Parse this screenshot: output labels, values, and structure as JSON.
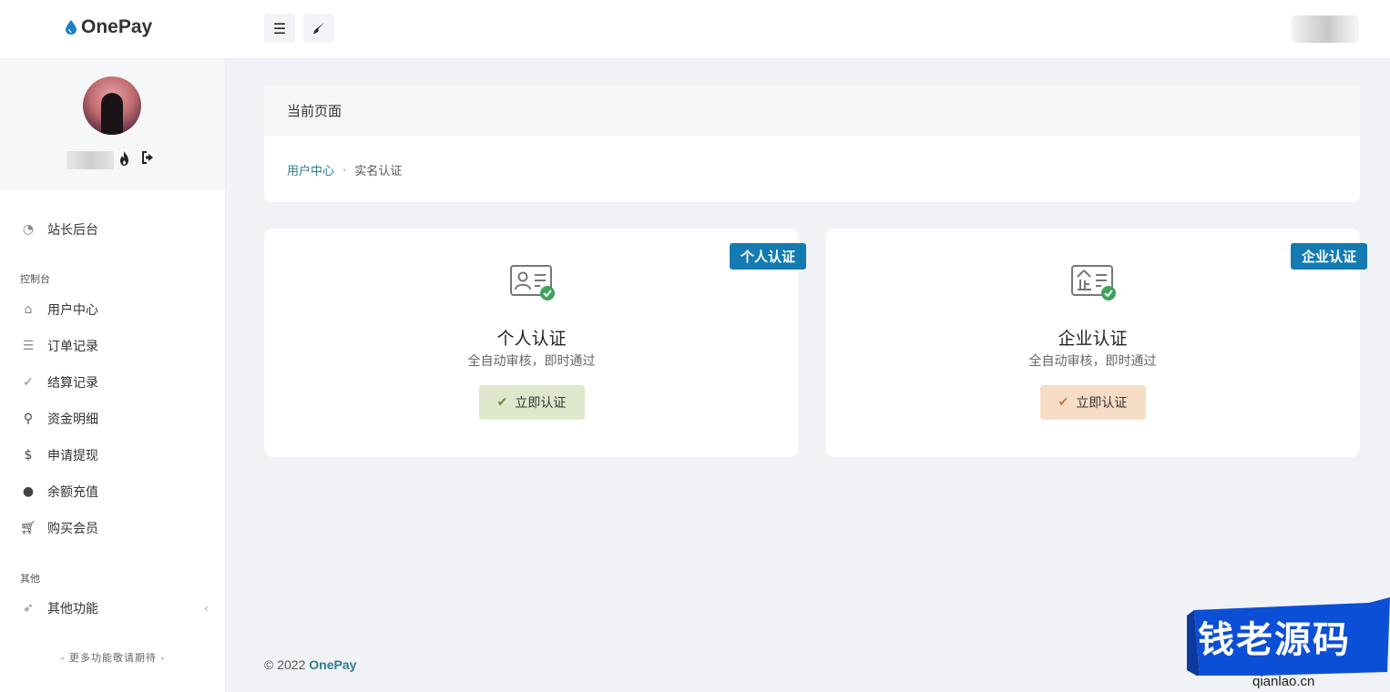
{
  "header": {
    "logo_text": "OnePay",
    "menu_icon": "hamburger-icon",
    "brush_icon": "brush-icon"
  },
  "sidebar": {
    "nav_items": [
      {
        "label": "站长后台",
        "icon": "dashboard-icon"
      },
      {
        "label": "用户中心",
        "icon": "home-icon"
      },
      {
        "label": "订单记录",
        "icon": "list-icon"
      },
      {
        "label": "结算记录",
        "icon": "check-circle-icon"
      },
      {
        "label": "资金明细",
        "icon": "search-money-icon"
      },
      {
        "label": "申请提现",
        "icon": "dollar-icon"
      },
      {
        "label": "余额充值",
        "icon": "coin-bag-icon"
      },
      {
        "label": "购买会员",
        "icon": "cart-icon"
      },
      {
        "label": "其他功能",
        "icon": "rocket-icon"
      }
    ],
    "section_console": "控制台",
    "section_other": "其他",
    "footer_text": "- 更多功能敬请期待 -"
  },
  "page": {
    "card_title": "当前页面",
    "breadcrumb_home": "用户中心",
    "breadcrumb_current": "实名认证"
  },
  "auth": {
    "personal": {
      "badge": "个人认证",
      "title": "个人认证",
      "desc": "全自动审核，即时通过",
      "button": "立即认证"
    },
    "business": {
      "badge": "企业认证",
      "title": "企业认证",
      "desc": "全自动审核，即时通过",
      "button": "立即认证"
    }
  },
  "footer": {
    "copyright": "© 2022",
    "brand": "OnePay"
  },
  "watermark": {
    "text": "钱老源码",
    "url": "qianlao.cn"
  },
  "colors": {
    "brand_blue": "#147ab2",
    "link_teal": "#2e7d8f",
    "green_btn": "#dde8cc",
    "orange_btn": "#f7dcc6"
  }
}
